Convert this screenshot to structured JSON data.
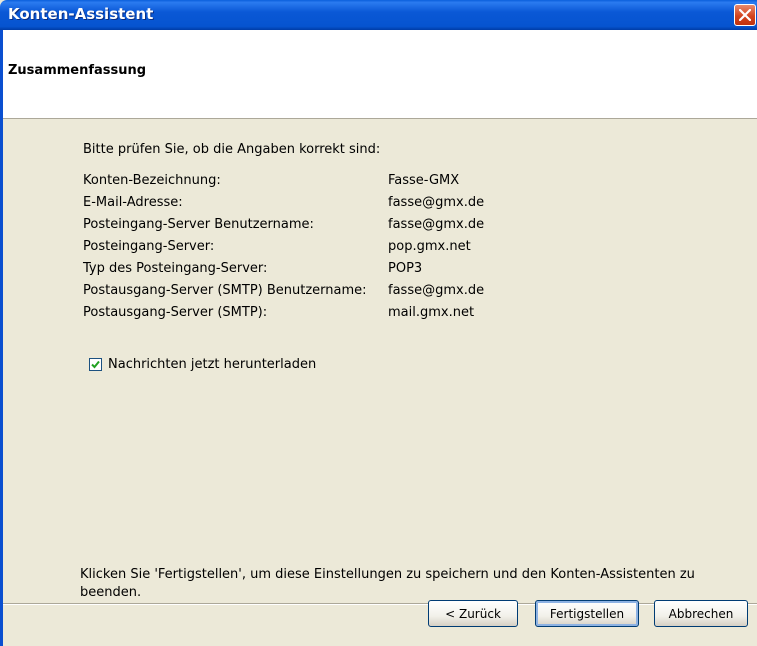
{
  "window": {
    "title": "Konten-Assistent"
  },
  "header": {
    "heading": "Zusammenfassung"
  },
  "content": {
    "intro": "Bitte prüfen Sie, ob die Angaben korrekt sind:",
    "summary": [
      {
        "label": "Konten-Bezeichnung:",
        "value": "Fasse-GMX"
      },
      {
        "label": "E-Mail-Adresse:",
        "value": "fasse@gmx.de"
      },
      {
        "label": "Posteingang-Server Benutzername:",
        "value": "fasse@gmx.de"
      },
      {
        "label": "Posteingang-Server:",
        "value": "pop.gmx.net"
      },
      {
        "label": "Typ des Posteingang-Server:",
        "value": "POP3"
      },
      {
        "label": "Postausgang-Server (SMTP) Benutzername:",
        "value": "fasse@gmx.de"
      },
      {
        "label": "Postausgang-Server (SMTP):",
        "value": "mail.gmx.net"
      }
    ],
    "checkbox": {
      "label": "Nachrichten jetzt herunterladen",
      "checked": true
    },
    "finish_text": "Klicken Sie 'Fertigstellen', um diese Einstellungen zu speichern und den Konten-Assistenten zu beenden."
  },
  "buttons": {
    "back": "< Zurück",
    "finish": "Fertigstellen",
    "cancel": "Abbrechen"
  },
  "colors": {
    "titlebar": "#0a58d6",
    "dialog_bg": "#ece9d8",
    "close_button": "#d3441f",
    "checkmark": "#21a121"
  }
}
